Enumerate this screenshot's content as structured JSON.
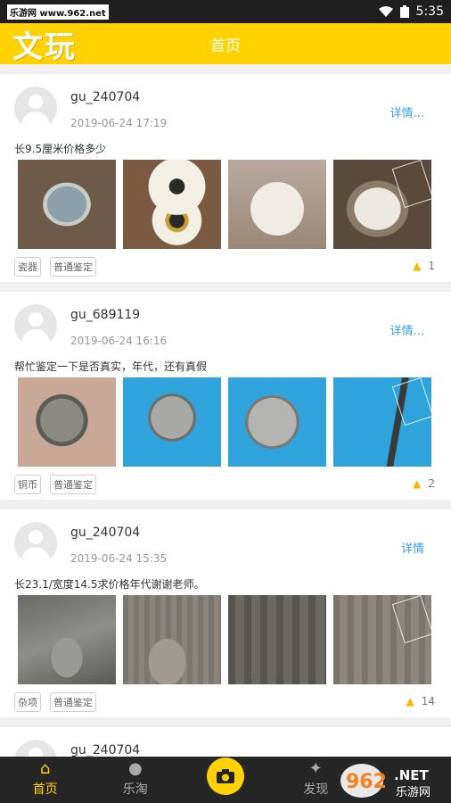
{
  "status": {
    "watermark": "乐游网 www.962.net",
    "time": "5:35"
  },
  "header": {
    "brand": "文玩",
    "title": "首页"
  },
  "posts": [
    {
      "user": "gu_240704",
      "time": "2019-06-24 17:19",
      "detail": "详情...",
      "desc": "长9.5厘米价格多少",
      "tags": [
        "瓷器",
        "普通鉴定"
      ],
      "likes": "1"
    },
    {
      "user": "gu_689119",
      "time": "2019-06-24 16:16",
      "detail": "详情...",
      "desc": "帮忙鉴定一下是否真实，年代，还有真假",
      "tags": [
        "铜币",
        "普通鉴定"
      ],
      "likes": "2"
    },
    {
      "user": "gu_240704",
      "time": "2019-06-24 15:35",
      "detail": "详情",
      "desc": "长23.1/宽度14.5求价格年代谢谢老师。",
      "tags": [
        "杂项",
        "普通鉴定"
      ],
      "likes": "14"
    },
    {
      "user": "gu_240704"
    }
  ],
  "nav": {
    "home": "首页",
    "taobao": "乐淘",
    "discover": "发现"
  },
  "badge": {
    "logo": "962",
    "net": ".NET",
    "name": "乐游网"
  },
  "colors": {
    "accent": "#ffd200",
    "link": "#3a9ee0",
    "navbar": "#262626"
  },
  "icons": {
    "wifi": "wifi-icon",
    "battery": "battery-icon",
    "home": "home-icon",
    "bulb": "bulb-icon",
    "camera": "camera-icon",
    "compass": "compass-icon",
    "fire": "fire-icon"
  }
}
